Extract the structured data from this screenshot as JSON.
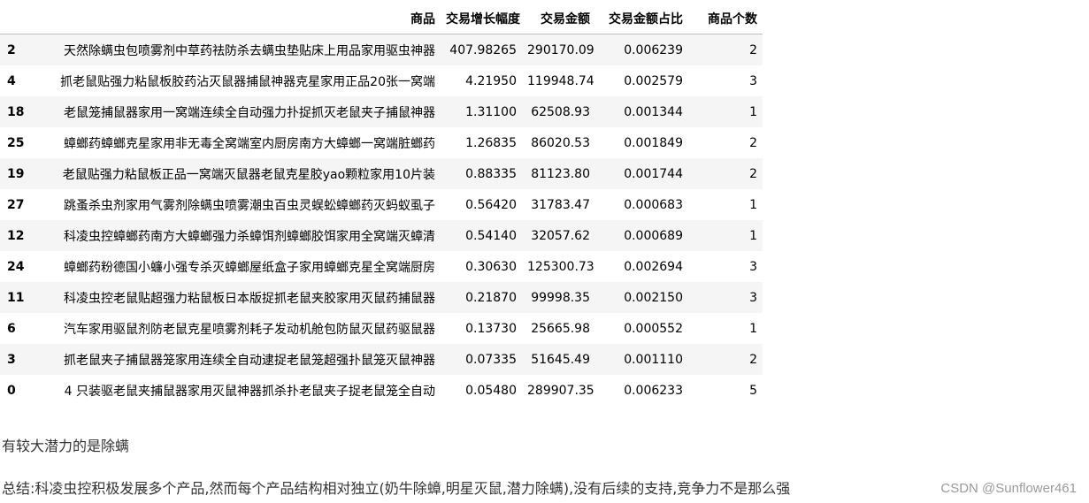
{
  "table": {
    "columns": [
      "",
      "商品",
      "交易增长幅度",
      "交易金额",
      "交易金额占比",
      "商品个数"
    ],
    "rows": [
      {
        "idx": "2",
        "name": "天然除螨虫包喷雾剂中草药祛防杀去螨虫垫贴床上用品家用驱虫神器",
        "growth": "407.98265",
        "amount": "290170.09",
        "ratio": "0.006239",
        "count": "2"
      },
      {
        "idx": "4",
        "name": "抓老鼠贴强力粘鼠板胶药沾灭鼠器捕鼠神器克星家用正品20张一窝端",
        "growth": "4.21950",
        "amount": "119948.74",
        "ratio": "0.002579",
        "count": "3"
      },
      {
        "idx": "18",
        "name": "老鼠笼捕鼠器家用一窝端连续全自动强力扑捉抓灭老鼠夹子捕鼠神器",
        "growth": "1.31100",
        "amount": "62508.93",
        "ratio": "0.001344",
        "count": "1"
      },
      {
        "idx": "25",
        "name": "蟑螂药蟑螂克星家用非无毒全窝端室内厨房南方大蟑螂一窝端脏螂药",
        "growth": "1.26835",
        "amount": "86020.53",
        "ratio": "0.001849",
        "count": "2"
      },
      {
        "idx": "19",
        "name": "老鼠贴强力粘鼠板正品一窝端灭鼠器老鼠克星胶yao颗粒家用10片装",
        "growth": "0.88335",
        "amount": "81123.80",
        "ratio": "0.001744",
        "count": "2"
      },
      {
        "idx": "27",
        "name": "跳蚤杀虫剂家用气雾剂除螨虫喷雾潮虫百虫灵蜈蚣蟑螂药灭蚂蚁虱子",
        "growth": "0.56420",
        "amount": "31783.47",
        "ratio": "0.000683",
        "count": "1"
      },
      {
        "idx": "12",
        "name": "科凌虫控蟑螂药南方大蟑螂强力杀蟑饵剂蟑螂胶饵家用全窝端灭蟑清",
        "growth": "0.54140",
        "amount": "32057.62",
        "ratio": "0.000689",
        "count": "1"
      },
      {
        "idx": "24",
        "name": "蟑螂药粉德国小蠊小强专杀灭蟑螂屋纸盒子家用蟑螂克星全窝端厨房",
        "growth": "0.30630",
        "amount": "125300.73",
        "ratio": "0.002694",
        "count": "3"
      },
      {
        "idx": "11",
        "name": "科凌虫控老鼠贴超强力粘鼠板日本版捉抓老鼠夹胶家用灭鼠药捕鼠器",
        "growth": "0.21870",
        "amount": "99998.35",
        "ratio": "0.002150",
        "count": "3"
      },
      {
        "idx": "6",
        "name": "汽车家用驱鼠剂防老鼠克星喷雾剂耗子发动机舱包防鼠灭鼠药驱鼠器",
        "growth": "0.13730",
        "amount": "25665.98",
        "ratio": "0.000552",
        "count": "1"
      },
      {
        "idx": "3",
        "name": "抓老鼠夹子捕鼠器笼家用连续全自动逮捉老鼠笼超强扑鼠笼灭鼠神器",
        "growth": "0.07335",
        "amount": "51645.49",
        "ratio": "0.001110",
        "count": "2"
      },
      {
        "idx": "0",
        "name": "4 只装驱老鼠夹捕鼠器家用灭鼠神器抓杀扑老鼠夹子捉老鼠笼全自动",
        "growth": "0.05480",
        "amount": "289907.35",
        "ratio": "0.006233",
        "count": "5"
      }
    ]
  },
  "notes": {
    "line1": "有较大潜力的是除螨",
    "line2": "总结:科凌虫控积极发展多个产品,然而每个产品结构相对独立(奶牛除蟑,明星灭鼠,潜力除螨),没有后续的支持,竞争力不是那么强"
  },
  "watermark": "CSDN @Sunflower461"
}
